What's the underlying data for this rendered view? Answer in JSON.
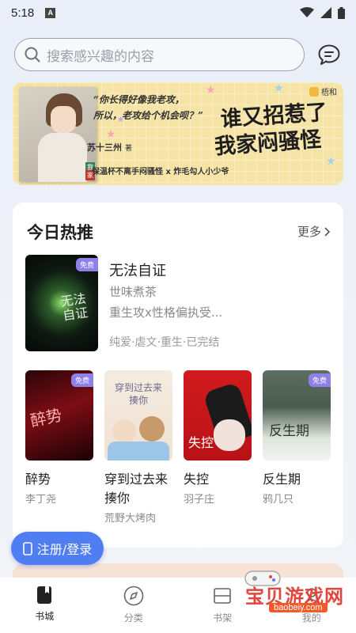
{
  "status_bar": {
    "time": "5:18",
    "notification_letter": "A"
  },
  "search": {
    "placeholder": "搜索感兴趣的内容"
  },
  "banner": {
    "quote_line1": "“你长得好像我老攻，",
    "quote_line2": "所以，老攻给个机会呗？”",
    "author": "苏十三州",
    "author_suffix": "著",
    "title_line1": "谁又招惹了",
    "title_line2": "我家闷骚怪",
    "tags": "保温杯不离手闷骚怪 x 炸毛勾人小少爷",
    "brand": "梧和",
    "cover_tag1": "我",
    "cover_tag2": "家"
  },
  "hot": {
    "section_title": "今日热推",
    "more_label": "更多",
    "featured": {
      "title": "无法自证",
      "author": "世味煮茶",
      "description": "重生攻x性格偏执受...",
      "tags": "纯爱·虐文·重生·已完结",
      "badge": "免费",
      "cover_text": "无法自证"
    },
    "books": [
      {
        "title": "醉势",
        "author": "李丁尧",
        "badge": "免费",
        "cover_text": "醉势"
      },
      {
        "title": "穿到过去来揍你",
        "author": "荒野大烤肉",
        "badge": "",
        "cover_text": "穿到过去来揍你"
      },
      {
        "title": "失控",
        "author": "羽子庄",
        "badge": "",
        "cover_text": "失控"
      },
      {
        "title": "反生期",
        "author": "鸦几只",
        "badge": "免费",
        "cover_text": "反生期"
      }
    ]
  },
  "register_button": {
    "label": "注册/登录"
  },
  "bottom_nav": {
    "items": [
      {
        "label": "书城",
        "icon": "bookstore-icon",
        "active": true
      },
      {
        "label": "分类",
        "icon": "compass-icon",
        "active": false
      },
      {
        "label": "书架",
        "icon": "bookshelf-icon",
        "active": false
      },
      {
        "label": "我的",
        "icon": "profile-icon",
        "active": false
      }
    ]
  },
  "watermark": {
    "text": "宝贝游戏网",
    "url": "baobeiy.com"
  },
  "colors": {
    "accent_blue": "#4f7df2",
    "badge_purple": "#8f7fe8",
    "banner_yellow": "#f6e4a6",
    "watermark_red": "#e1453c"
  }
}
